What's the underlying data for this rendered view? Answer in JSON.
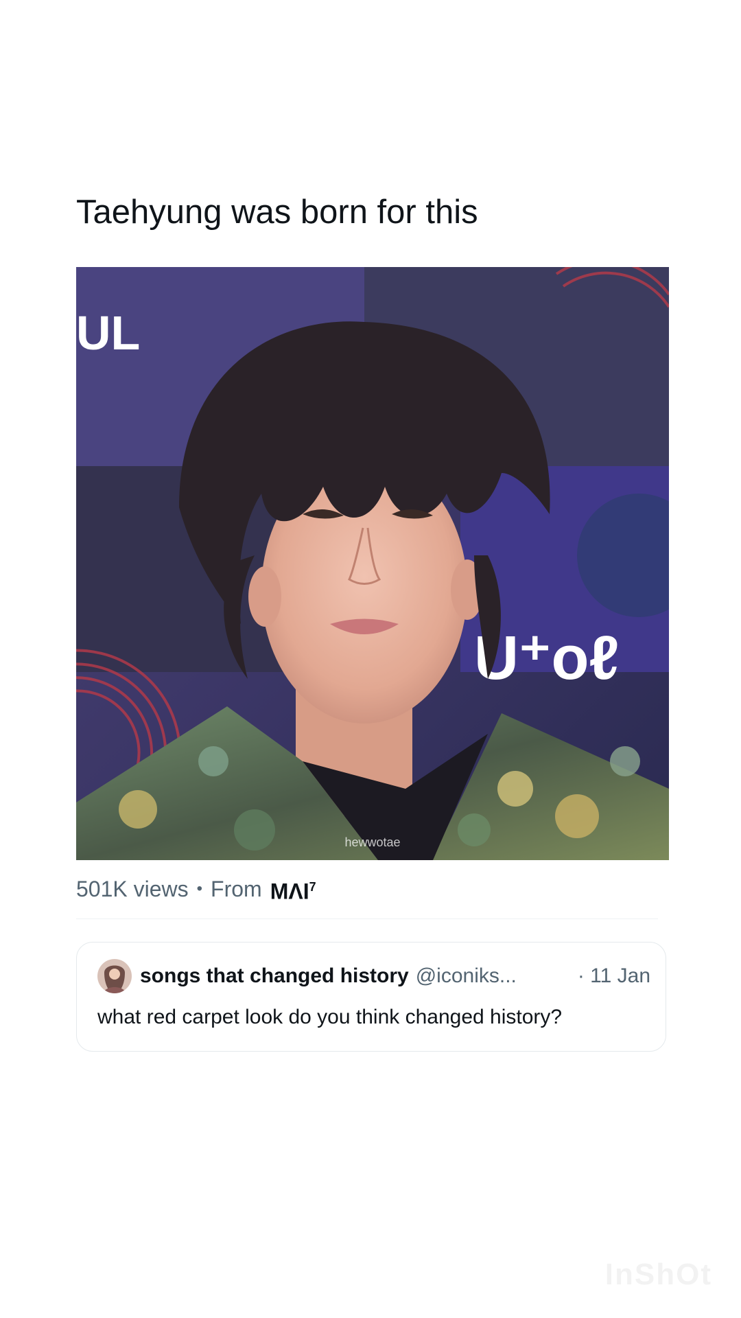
{
  "tweet": {
    "text": "Taehyung was born for this"
  },
  "media": {
    "description_icon": "photo",
    "watermark": "hewwotae",
    "backdrop_text_left": "UL",
    "backdrop_text_right": "U⁺oℓ"
  },
  "meta": {
    "views": "501K views",
    "separator": "•",
    "from_label": "From",
    "from_name": "MΛI",
    "from_sup": "7"
  },
  "quote": {
    "name": "songs that changed history",
    "handle": "@iconiks...",
    "date": "· 11 Jan",
    "text": "what red carpet look do you think changed history?"
  },
  "corner_watermark": "InShOt",
  "colors": {
    "text_primary": "#0f1419",
    "text_secondary": "#536471",
    "border": "#e4e9ec"
  }
}
